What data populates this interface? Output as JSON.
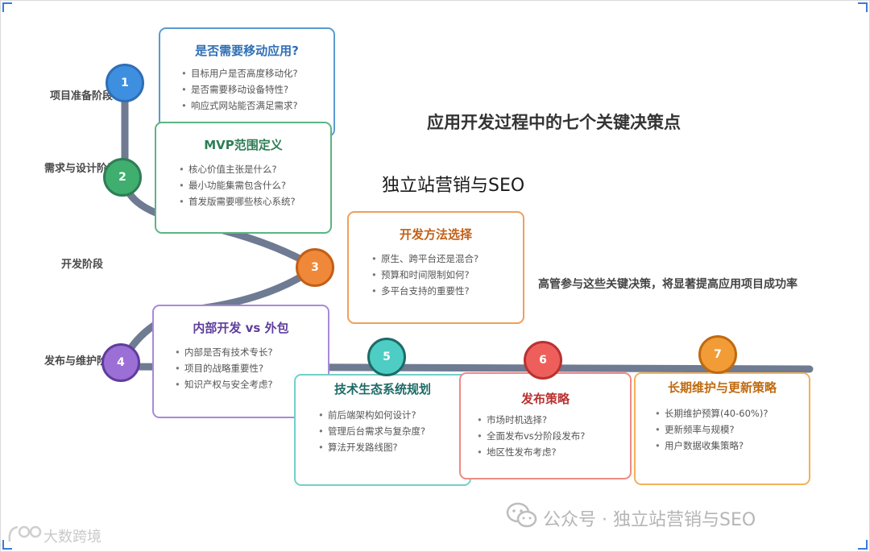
{
  "title": "应用开发过程中的七个关键决策点",
  "subtitle": "独立站营销与SEO",
  "note": "高管参与这些关键决策，将显著提高应用项目成功率",
  "stages": [
    "项目准备阶段",
    "需求与设计阶段",
    "开发阶段",
    "发布与维护阶段"
  ],
  "nodes": [
    {
      "num": "1",
      "color": "#3f8fe0"
    },
    {
      "num": "2",
      "color": "#3fae6e"
    },
    {
      "num": "3",
      "color": "#f0883a"
    },
    {
      "num": "4",
      "color": "#9b6fd6"
    },
    {
      "num": "5",
      "color": "#4ecdc4"
    },
    {
      "num": "6",
      "color": "#ee5f5b"
    },
    {
      "num": "7",
      "color": "#f29c38"
    }
  ],
  "cards": [
    {
      "title": "是否需要移动应用?",
      "color": "#2f6fb5",
      "border": "#5a9ad1",
      "items": [
        "目标用户是否高度移动化?",
        "是否需要移动设备特性?",
        "响应式网站能否满足需求?"
      ]
    },
    {
      "title": "MVP范围定义",
      "color": "#2e7d55",
      "border": "#5bb583",
      "items": [
        "核心价值主张是什么?",
        "最小功能集需包含什么?",
        "首发版需要哪些核心系统?"
      ]
    },
    {
      "title": "开发方法选择",
      "color": "#c25f17",
      "border": "#f0a05a",
      "items": [
        "原生、跨平台还是混合?",
        "预算和时间限制如何?",
        "多平台支持的重要性?"
      ]
    },
    {
      "title": "内部开发 vs 外包",
      "color": "#5f3d9c",
      "border": "#a98ad8",
      "items": [
        "内部是否有技术专长?",
        "项目的战略重要性?",
        "知识产权与安全考虑?"
      ]
    },
    {
      "title": "技术生态系统规划",
      "color": "#1d6b66",
      "border": "#73cfc7",
      "items": [
        "前后端架构如何设计?",
        "管理后台需求与复杂度?",
        "算法开发路线图?"
      ]
    },
    {
      "title": "发布策略",
      "color": "#b83232",
      "border": "#ef8a86",
      "items": [
        "市场时机选择?",
        "全面发布vs分阶段发布?",
        "地区性发布考虑?"
      ]
    },
    {
      "title": "长期维护与更新策略",
      "color": "#bf6a10",
      "border": "#f2b25a",
      "items": [
        "长期维护预算(40-60%)?",
        "更新频率与规模?",
        "用户数据收集策略?"
      ]
    }
  ],
  "watermark": {
    "wechat": "公众号 · 独立站营销与SEO",
    "brand": "大数跨境"
  },
  "colors": {
    "path": "#6e7b92"
  }
}
